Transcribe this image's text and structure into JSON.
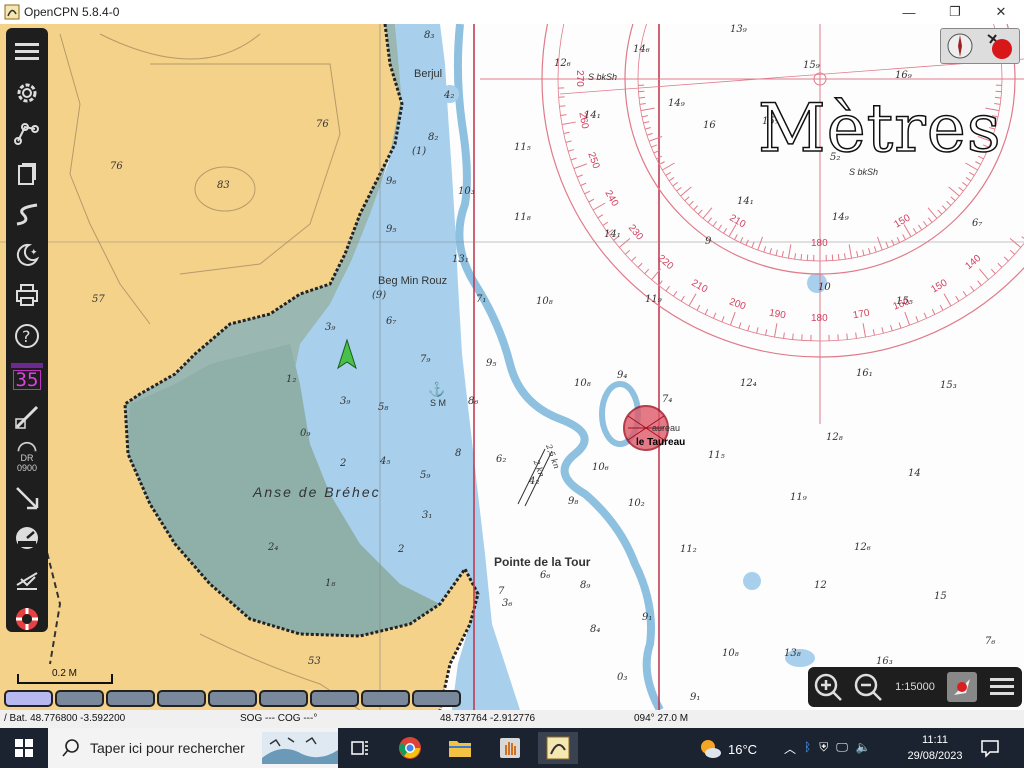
{
  "window": {
    "title": "OpenCPN 5.8.4-0",
    "controls": {
      "minimize": "—",
      "maximize": "❐",
      "close": "✕"
    }
  },
  "chart": {
    "units_overlay": "Mètres",
    "place_names": {
      "berjul": "Berjul",
      "beg_min_rouz": "Beg Min Rouz",
      "anse": "Anse de Bréhec",
      "pointe": "Pointe de la Tour",
      "taureau": "le Taureau",
      "taureau_partial": "aureau",
      "sm": "S M",
      "sbksh_top": "S bkSh",
      "sbksh_mid": "S bkSh"
    },
    "land_heights": [
      "76",
      "83",
      "76",
      "57",
      "53"
    ],
    "marks": [
      "(1)",
      "(9)",
      "2,5 kn",
      "2 kn"
    ],
    "compass_rose_ticks": [
      "270",
      "260",
      "250",
      "240",
      "230",
      "220",
      "210",
      "200",
      "190",
      "180",
      "170",
      "160",
      "150",
      "140",
      "210",
      "180",
      "150"
    ],
    "soundings": [
      "8₃",
      "12₆",
      "14₆",
      "13₉",
      "15₉",
      "16₉",
      "4₂",
      "8₂",
      "14₉",
      "14₁",
      "15₇",
      "11₅",
      "14₁",
      "5₂",
      "9₆",
      "10₃",
      "11₈",
      "14₁",
      "16",
      "14₉",
      "6₇",
      "9₅",
      "13₁",
      "9",
      "10",
      "7₁",
      "10₈",
      "15₅",
      "3₉",
      "6₇",
      "11₉",
      "7₉",
      "9₅",
      "16₁",
      "12₄",
      "15₃",
      "1₂",
      "3₉",
      "5₈",
      "8₆",
      "10₈",
      "9₄",
      "7₄",
      "0₉",
      "2",
      "4₅",
      "5₉",
      "6₂",
      "8",
      "4₂",
      "12₈",
      "11₅",
      "10₆",
      "14",
      "3₁",
      "2",
      "9₈",
      "10₂",
      "11₉",
      "2₄",
      "12₆",
      "1₈",
      "11₂",
      "6₆",
      "8₉",
      "7",
      "12",
      "15",
      "3₆",
      "8₄",
      "9₁",
      "10₈",
      "9₁",
      "13₈",
      "16₃",
      "7₆",
      "0₃"
    ]
  },
  "toolbar": {
    "items": [
      "menu",
      "settings",
      "route",
      "tracks",
      "documents",
      "current",
      "moon-tide",
      "print",
      "help",
      "layer-35",
      "waypoint",
      "dead-reckoning",
      "arrow",
      "dashboard",
      "anchor",
      "rescue"
    ],
    "layer_label": "35",
    "dr_label": "DR",
    "dr_time": "0900"
  },
  "zoom": {
    "scale_label": "1:15000"
  },
  "scalebar": {
    "label": "0.2 M"
  },
  "piano": {
    "count": 9,
    "active_index": 0
  },
  "status": {
    "bat": "/ Bat. 48.776800   -3.592200",
    "sog_cog": "SOG --- COG ---°",
    "cursor": "48.737764   -2.912776",
    "bearing_dist": "094°  27.0 M"
  },
  "taskbar": {
    "search_placeholder": "Taper ici pour rechercher",
    "weather": "16°C",
    "time": "11:11",
    "date": "29/08/2023"
  },
  "colors": {
    "land": "#f5d28a",
    "drying": "#8fb0a8",
    "shallow": "#a8d0ec",
    "deep": "#ffffff",
    "red_lines": "#c0304a",
    "toolbar_bg": "#1e1e1e",
    "taskbar_bg": "#1c2330"
  }
}
